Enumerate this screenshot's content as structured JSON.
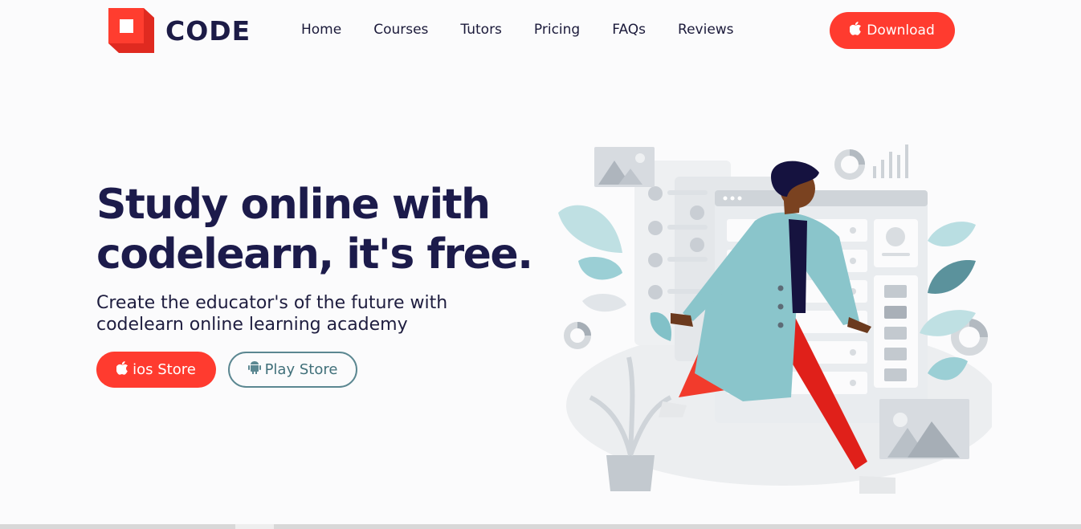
{
  "header": {
    "logo_text": "CODE",
    "nav": [
      "Home",
      "Courses",
      "Tutors",
      "Pricing",
      "FAQs",
      "Reviews"
    ],
    "download_label": "Download"
  },
  "hero": {
    "title_line1": "Study online with",
    "title_line2": "codelearn, it's free.",
    "subtitle_line1": "Create the educator's of the future with",
    "subtitle_line2": "codelearn online learning academy",
    "ios_label": "ios Store",
    "play_label": "Play Store"
  },
  "colors": {
    "accent": "#ff3b2f",
    "navy": "#1c1b4b",
    "teal": "#82c1c8",
    "secondary_outline": "#5b8791"
  },
  "icons": {
    "logo": "code-logo-icon",
    "apple": "apple-icon",
    "android": "android-icon"
  }
}
